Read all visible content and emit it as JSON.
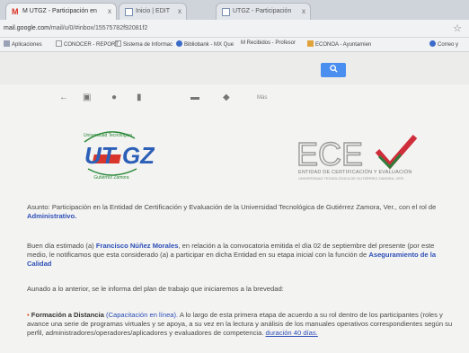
{
  "browser": {
    "tabs": [
      {
        "label": "M UTGZ - Participación en",
        "close": "x"
      },
      {
        "label": "Inicio | EDIT",
        "close": "x"
      },
      {
        "label": "UTGZ - Participación",
        "close": "x"
      }
    ],
    "url": {
      "host": "mail.google.com",
      "rest": "/mail/u/0/#inbox/15575782f92081f2"
    },
    "bookmarks": [
      "Aplicaciones",
      "CONOCER - REPORT",
      "Sistema de Informac",
      "Bibliobank - MX Que",
      "M Recibidos - Profesor",
      "ECONOA - Ayuntamien",
      "Correo y"
    ]
  },
  "gmail": {
    "search_icon": "search-icon",
    "toolbar_more": "Más"
  },
  "email": {
    "ece_logo": "ECE",
    "ece_tagline": "ENTIDAD DE CERTIFICACIÓN Y EVALUACIÓN",
    "ece_subline": "UNIVERSIDAD TECNOLÓGICA DE GUTIÉRREZ ZAMORA, VER.",
    "utgz_logo": "UT GZ",
    "utgz_top": "Universidad Tecnológica",
    "utgz_bottom": "Gutiérrez Zamora",
    "asunto_prefix": "Asunto: Participación en la Entidad de Certificación y Evaluación de la Universidad Tecnológica de Gutiérrez Zamora, Ver., con el rol de",
    "asunto_role": "Administrativo.",
    "greeting_prefix": "Buen día estimado (a)",
    "recipient": "Francisco Núñez Morales",
    "greeting_mid": ", en relación a la convocatoria emitida el día 02 de septiembre del presente (por este medio, le notificamos que esta considerado (a) a participar en dicha Entidad en su etapa inicial con la función de",
    "function": "Aseguramiento de la Calidad",
    "plan_text": "Aunado a lo anterior, se le informa del plan de trabajo que iniciaremos a la brevedad:",
    "bullet_title": "Formación a Distancia",
    "bullet_paren": "(Capacitación en línea).",
    "bullet_text": "A lo largo de esta primera etapa de acuerdo a su rol dentro de los participantes (roles y avance una serie de programas virtuales y se apoya, a su vez en la lectura y análisis de los manuales operativos correspondientes según su perfil, administradores/operadores/aplicadores y evaluadores de competencia.",
    "bullet_duration": "duración 40 días."
  },
  "colors": {
    "accent_blue": "#2d4fb8",
    "search_blue": "#4a8ef0",
    "ece_green": "#2e7d3a",
    "ece_red": "#cf2d3a",
    "utgz_blue": "#2c5fb8"
  }
}
